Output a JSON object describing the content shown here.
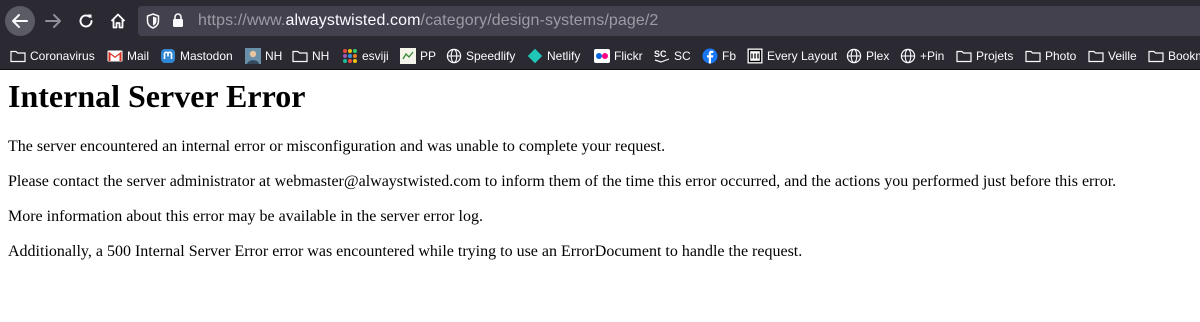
{
  "browser": {
    "url": {
      "prefix": "https://www.",
      "host": "alwaystwisted.com",
      "path": "/category/design-systems/page/2"
    },
    "icons": {
      "back": "back-arrow-icon",
      "forward": "forward-arrow-icon",
      "reload": "reload-icon",
      "home": "home-icon",
      "tracking": "shield-icon",
      "security": "lock-icon"
    }
  },
  "bookmarks": [
    {
      "label": "Coronavirus",
      "icon": "folder-icon"
    },
    {
      "label": "Mail",
      "icon": "gmail-icon"
    },
    {
      "label": "Mastodon",
      "icon": "mastodon-icon"
    },
    {
      "label": "NH",
      "icon": "avatar-icon"
    },
    {
      "label": "NH",
      "icon": "folder-icon"
    },
    {
      "label": "esviji",
      "icon": "esviji-icon"
    },
    {
      "label": "PP",
      "icon": "pp-icon"
    },
    {
      "label": "Speedlify",
      "icon": "globe-icon"
    },
    {
      "label": "Netlify",
      "icon": "netlify-icon"
    },
    {
      "label": "Flickr",
      "icon": "flickr-icon"
    },
    {
      "label": "SC",
      "icon": "sc-icon"
    },
    {
      "label": "Fb",
      "icon": "facebook-icon"
    },
    {
      "label": "Every Layout",
      "icon": "every-layout-icon"
    },
    {
      "label": "Plex",
      "icon": "globe-icon"
    },
    {
      "label": "+Pin",
      "icon": "globe-icon"
    },
    {
      "label": "Projets",
      "icon": "folder-icon"
    },
    {
      "label": "Photo",
      "icon": "folder-icon"
    },
    {
      "label": "Veille",
      "icon": "folder-icon"
    },
    {
      "label": "Bookm",
      "icon": "folder-icon"
    }
  ],
  "page": {
    "title": "Internal Server Error",
    "paragraphs": [
      "The server encountered an internal error or misconfiguration and was unable to complete your request.",
      "Please contact the server administrator at webmaster@alwaystwisted.com to inform them of the time this error occurred, and the actions you performed just before this error.",
      "More information about this error may be available in the server error log.",
      "Additionally, a 500 Internal Server Error error was encountered while trying to use an ErrorDocument to handle the request."
    ]
  },
  "colors": {
    "toolbar_bg": "#2b2a33",
    "urlbar_bg": "#42414d",
    "text_light": "#fbfbfe",
    "url_dim": "#9d9ca4"
  }
}
